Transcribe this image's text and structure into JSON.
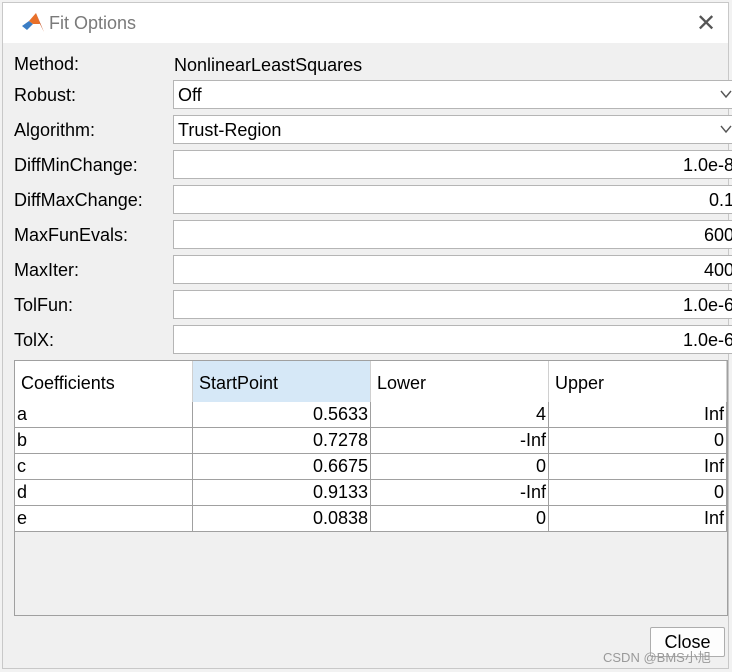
{
  "window": {
    "title": "Fit Options",
    "close_icon": "✕"
  },
  "form": {
    "method": {
      "label": "Method:",
      "value": "NonlinearLeastSquares"
    },
    "robust": {
      "label": "Robust:",
      "value": "Off"
    },
    "algorithm": {
      "label": "Algorithm:",
      "value": "Trust-Region"
    },
    "diffminchange": {
      "label": "DiffMinChange:",
      "value": "1.0e-8"
    },
    "diffmaxchange": {
      "label": "DiffMaxChange:",
      "value": "0.1"
    },
    "maxfunevals": {
      "label": "MaxFunEvals:",
      "value": "600"
    },
    "maxiter": {
      "label": "MaxIter:",
      "value": "400"
    },
    "tolfun": {
      "label": "TolFun:",
      "value": "1.0e-6"
    },
    "tolx": {
      "label": "TolX:",
      "value": "1.0e-6"
    }
  },
  "table": {
    "headers": [
      "Coefficients",
      "StartPoint",
      "Lower",
      "Upper"
    ],
    "rows": [
      [
        "a",
        "0.5633",
        "4",
        "Inf"
      ],
      [
        "b",
        "0.7278",
        "-Inf",
        "0"
      ],
      [
        "c",
        "0.6675",
        "0",
        "Inf"
      ],
      [
        "d",
        "0.9133",
        "-Inf",
        "0"
      ],
      [
        "e",
        "0.0838",
        "0",
        "Inf"
      ]
    ]
  },
  "buttons": {
    "close": "Close"
  },
  "watermark": "CSDN @BMS小旭",
  "colors": {
    "selected_header": "#d6e8f7",
    "dialog_bg": "#f0f0f0"
  }
}
